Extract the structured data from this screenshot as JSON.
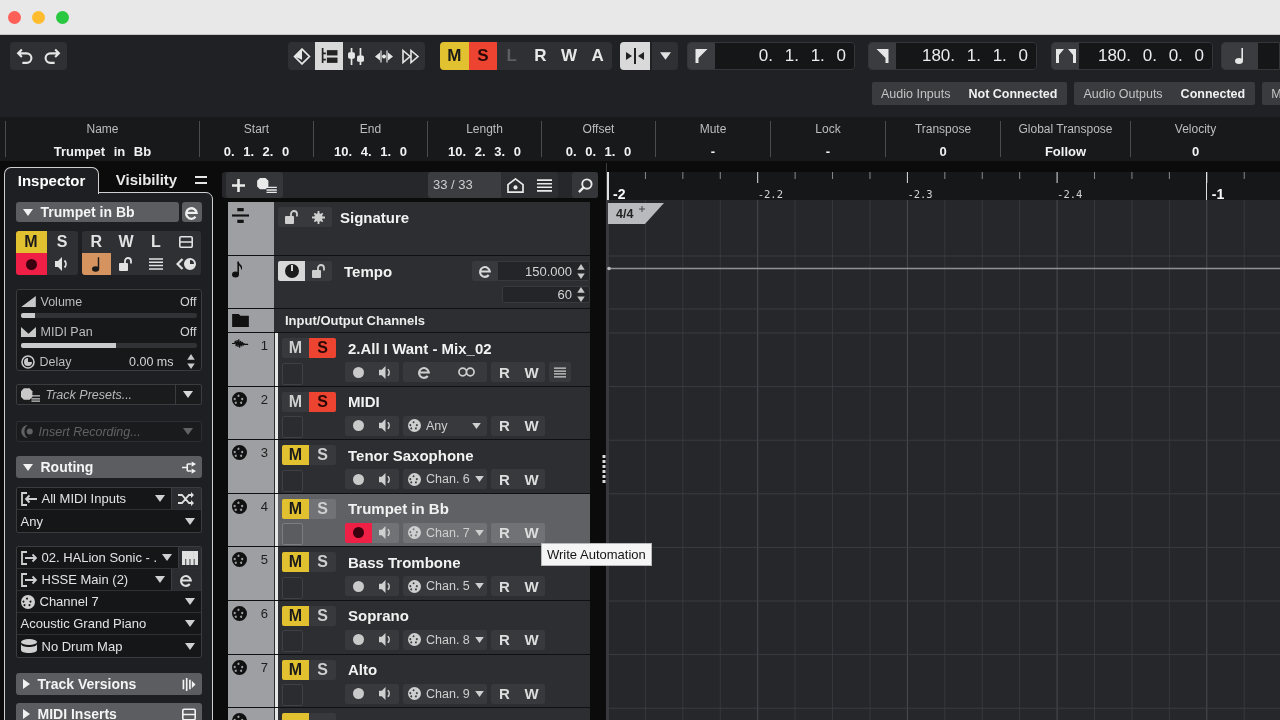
{
  "toolbar": {
    "view_buttons": [
      {
        "selected": false
      },
      {
        "selected": true
      },
      {
        "selected": false
      },
      {
        "selected": false
      },
      {
        "selected": false
      }
    ],
    "track_buttons": [
      {
        "kind": "mute",
        "label": "M",
        "on": true,
        "disabled": false
      },
      {
        "kind": "solo",
        "label": "S",
        "on": true,
        "disabled": false
      },
      {
        "kind": "listen",
        "label": "L",
        "on": false,
        "disabled": true
      },
      {
        "kind": "read",
        "label": "R",
        "on": false,
        "disabled": false
      },
      {
        "kind": "write",
        "label": "W",
        "on": false,
        "disabled": false
      },
      {
        "kind": "automation",
        "label": "A",
        "on": false,
        "disabled": false
      }
    ],
    "autoscroll": {
      "on": true
    },
    "locators": [
      {
        "kind": "left",
        "value": "0. 1. 1. 0"
      },
      {
        "kind": "right",
        "value": "180. 1. 1. 0"
      },
      {
        "kind": "length",
        "value": "180. 0. 0. 0"
      }
    ],
    "connections": [
      {
        "label": "Audio Inputs",
        "status": "Not Connected"
      },
      {
        "label": "Audio Outputs",
        "status": "Connected"
      },
      {
        "label": "M"
      }
    ]
  },
  "info_line": [
    {
      "label": "Name",
      "value": "Trumpet in Bb"
    },
    {
      "label": "Start",
      "value": "0. 1. 2. 0"
    },
    {
      "label": "End",
      "value": "10. 4. 1. 0"
    },
    {
      "label": "Length",
      "value": "10. 2. 3. 0"
    },
    {
      "label": "Offset",
      "value": "0. 0. 1. 0"
    },
    {
      "label": "Mute",
      "value": "-"
    },
    {
      "label": "Lock",
      "value": "-"
    },
    {
      "label": "Transpose",
      "value": "0"
    },
    {
      "label": "Global Transpose",
      "value": "Follow"
    },
    {
      "label": "Velocity",
      "value": "0"
    }
  ],
  "inspector": {
    "tabs": [
      {
        "label": "Inspector",
        "selected": true
      },
      {
        "label": "Visibility",
        "selected": false
      }
    ],
    "track": {
      "name": "Trumpet in Bb",
      "expanded": true
    },
    "left_buttons": [
      {
        "kind": "mute",
        "label": "M",
        "on": true
      },
      {
        "kind": "solo",
        "label": "S",
        "on": false
      },
      {
        "kind": "record",
        "on": true
      },
      {
        "kind": "monitor",
        "on": false
      }
    ],
    "right_buttons": [
      {
        "kind": "read",
        "label": "R",
        "on": false
      },
      {
        "kind": "write",
        "label": "W",
        "on": false
      },
      {
        "kind": "lanes",
        "label": "L",
        "on": false
      },
      {
        "kind": "editor",
        "on": false
      },
      {
        "kind": "timebase",
        "on": true
      },
      {
        "kind": "lock",
        "on": false
      },
      {
        "kind": "list",
        "on": false
      },
      {
        "kind": "clock",
        "on": false
      }
    ],
    "faders": [
      {
        "label": "Volume",
        "reading": "Off",
        "level": 0.08
      },
      {
        "label": "MIDI Pan",
        "reading": "Off",
        "level": 0.54
      }
    ],
    "delay": {
      "label": "Delay",
      "reading": "0.00 ms"
    },
    "presets": {
      "placeholder": "Track Presets..."
    },
    "insert_recording": {
      "placeholder": "Insert Recording...",
      "disabled": true
    },
    "routing": {
      "title": "Routing",
      "expanded": true,
      "inputs": [
        {
          "kind": "input",
          "value": "All MIDI Inputs"
        },
        {
          "kind": "plain",
          "value": "Any"
        }
      ],
      "outputs": [
        {
          "kind": "output",
          "value": "02. HALion Sonic - ."
        },
        {
          "kind": "output",
          "value": "HSSE Main (2)"
        },
        {
          "kind": "channel",
          "value": "Channel 7"
        },
        {
          "kind": "plain",
          "value": "Acoustic Grand Piano"
        },
        {
          "kind": "drum",
          "value": "No Drum Map"
        }
      ]
    },
    "sections": [
      {
        "title": "Track Versions",
        "expanded": false
      },
      {
        "title": "MIDI Inserts",
        "expanded": false
      }
    ]
  },
  "track_list": {
    "count": "33 / 33",
    "signature": {
      "name": "Signature"
    },
    "tempo": {
      "name": "Tempo",
      "active": true,
      "tempo": "150.000",
      "value": "60"
    },
    "folder": {
      "name": "Input/Output Channels"
    },
    "tracks": [
      {
        "number": "1",
        "kind": "audio",
        "name": "2.All I Want - Mix_02",
        "mute": {
          "label": "M",
          "on": false
        },
        "solo": {
          "label": "S",
          "on": true
        },
        "record": false,
        "automation": [
          "R",
          "W"
        ],
        "selected": false
      },
      {
        "number": "2",
        "kind": "midi",
        "name": "MIDI",
        "mute": {
          "label": "M",
          "on": false
        },
        "solo": {
          "label": "S",
          "on": true
        },
        "record": false,
        "channel": "Any",
        "automation": [
          "R",
          "W"
        ],
        "selected": false
      },
      {
        "number": "3",
        "kind": "midi",
        "name": "Tenor Saxophone",
        "mute": {
          "label": "M",
          "on": true
        },
        "solo": {
          "label": "S",
          "on": false
        },
        "record": false,
        "channel": "Chan. 6",
        "automation": [
          "R",
          "W"
        ],
        "selected": false
      },
      {
        "number": "4",
        "kind": "midi",
        "name": "Trumpet in Bb",
        "mute": {
          "label": "M",
          "on": true
        },
        "solo": {
          "label": "S",
          "on": false
        },
        "record": true,
        "channel": "Chan. 7",
        "automation": [
          "R",
          "W"
        ],
        "selected": true
      },
      {
        "number": "5",
        "kind": "midi",
        "name": "Bass Trombone",
        "mute": {
          "label": "M",
          "on": true
        },
        "solo": {
          "label": "S",
          "on": false
        },
        "record": false,
        "channel": "Chan. 5",
        "automation": [
          "R",
          "W"
        ],
        "selected": false
      },
      {
        "number": "6",
        "kind": "midi",
        "name": "Soprano",
        "mute": {
          "label": "M",
          "on": true
        },
        "solo": {
          "label": "S",
          "on": false
        },
        "record": false,
        "channel": "Chan. 8",
        "automation": [
          "R",
          "W"
        ],
        "selected": false
      },
      {
        "number": "7",
        "kind": "midi",
        "name": "Alto",
        "mute": {
          "label": "M",
          "on": true
        },
        "solo": {
          "label": "S",
          "on": false
        },
        "record": false,
        "channel": "Chan. 9",
        "automation": [
          "R",
          "W"
        ],
        "selected": false
      },
      {
        "kind": "midi",
        "mute": {
          "on": true
        },
        "selected": false
      }
    ]
  },
  "arrangement": {
    "ruler": [
      {
        "label": "-2",
        "kind": "bar"
      },
      {
        "label": "-2.2",
        "kind": "beat"
      },
      {
        "label": "-2.3",
        "kind": "beat"
      },
      {
        "label": "-2.4",
        "kind": "beat"
      },
      {
        "label": "-1",
        "kind": "bar"
      }
    ],
    "signature_marker": "4/4"
  },
  "tooltip": {
    "text": "Write Automation"
  }
}
